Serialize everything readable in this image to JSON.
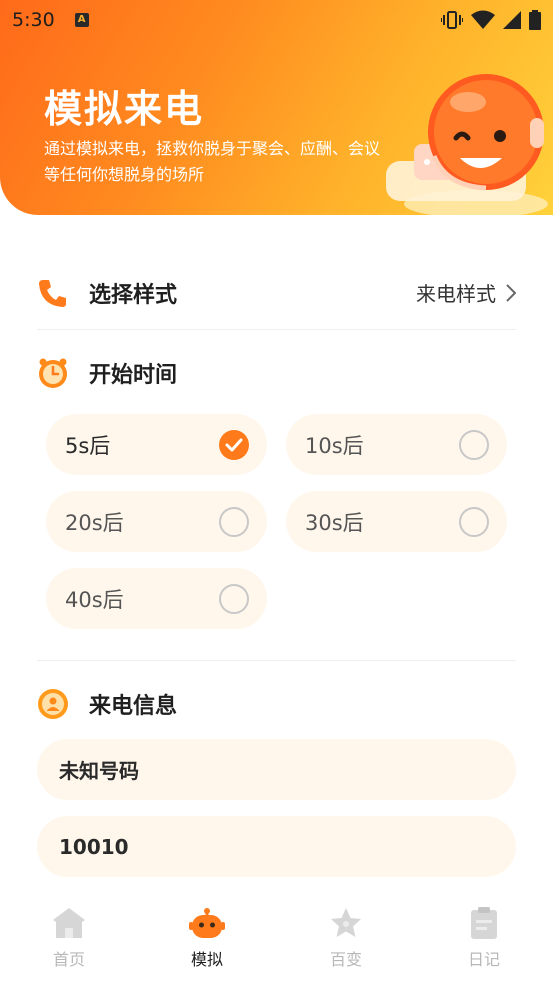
{
  "status_bar": {
    "time": "5:30",
    "app_badge": "A"
  },
  "hero": {
    "title": "模拟来电",
    "description": "通过模拟来电，拯救你脱身于聚会、应酬、会议等任何你想脱身的场所"
  },
  "style_row": {
    "label": "选择样式",
    "value": "来电样式"
  },
  "start_time": {
    "label": "开始时间",
    "options": [
      {
        "label": "5s后",
        "selected": true
      },
      {
        "label": "10s后",
        "selected": false
      },
      {
        "label": "20s后",
        "selected": false
      },
      {
        "label": "30s后",
        "selected": false
      },
      {
        "label": "40s后",
        "selected": false
      }
    ]
  },
  "call_info": {
    "label": "来电信息",
    "name_value": "未知号码",
    "number_value": "10010"
  },
  "tabs": [
    {
      "label": "首页",
      "icon": "home-icon",
      "active": false
    },
    {
      "label": "模拟",
      "icon": "robot-icon",
      "active": true
    },
    {
      "label": "百变",
      "icon": "star-icon",
      "active": false
    },
    {
      "label": "日记",
      "icon": "diary-icon",
      "active": false
    }
  ],
  "colors": {
    "accent": "#ff7a1a",
    "field_bg": "#fff7ec"
  }
}
